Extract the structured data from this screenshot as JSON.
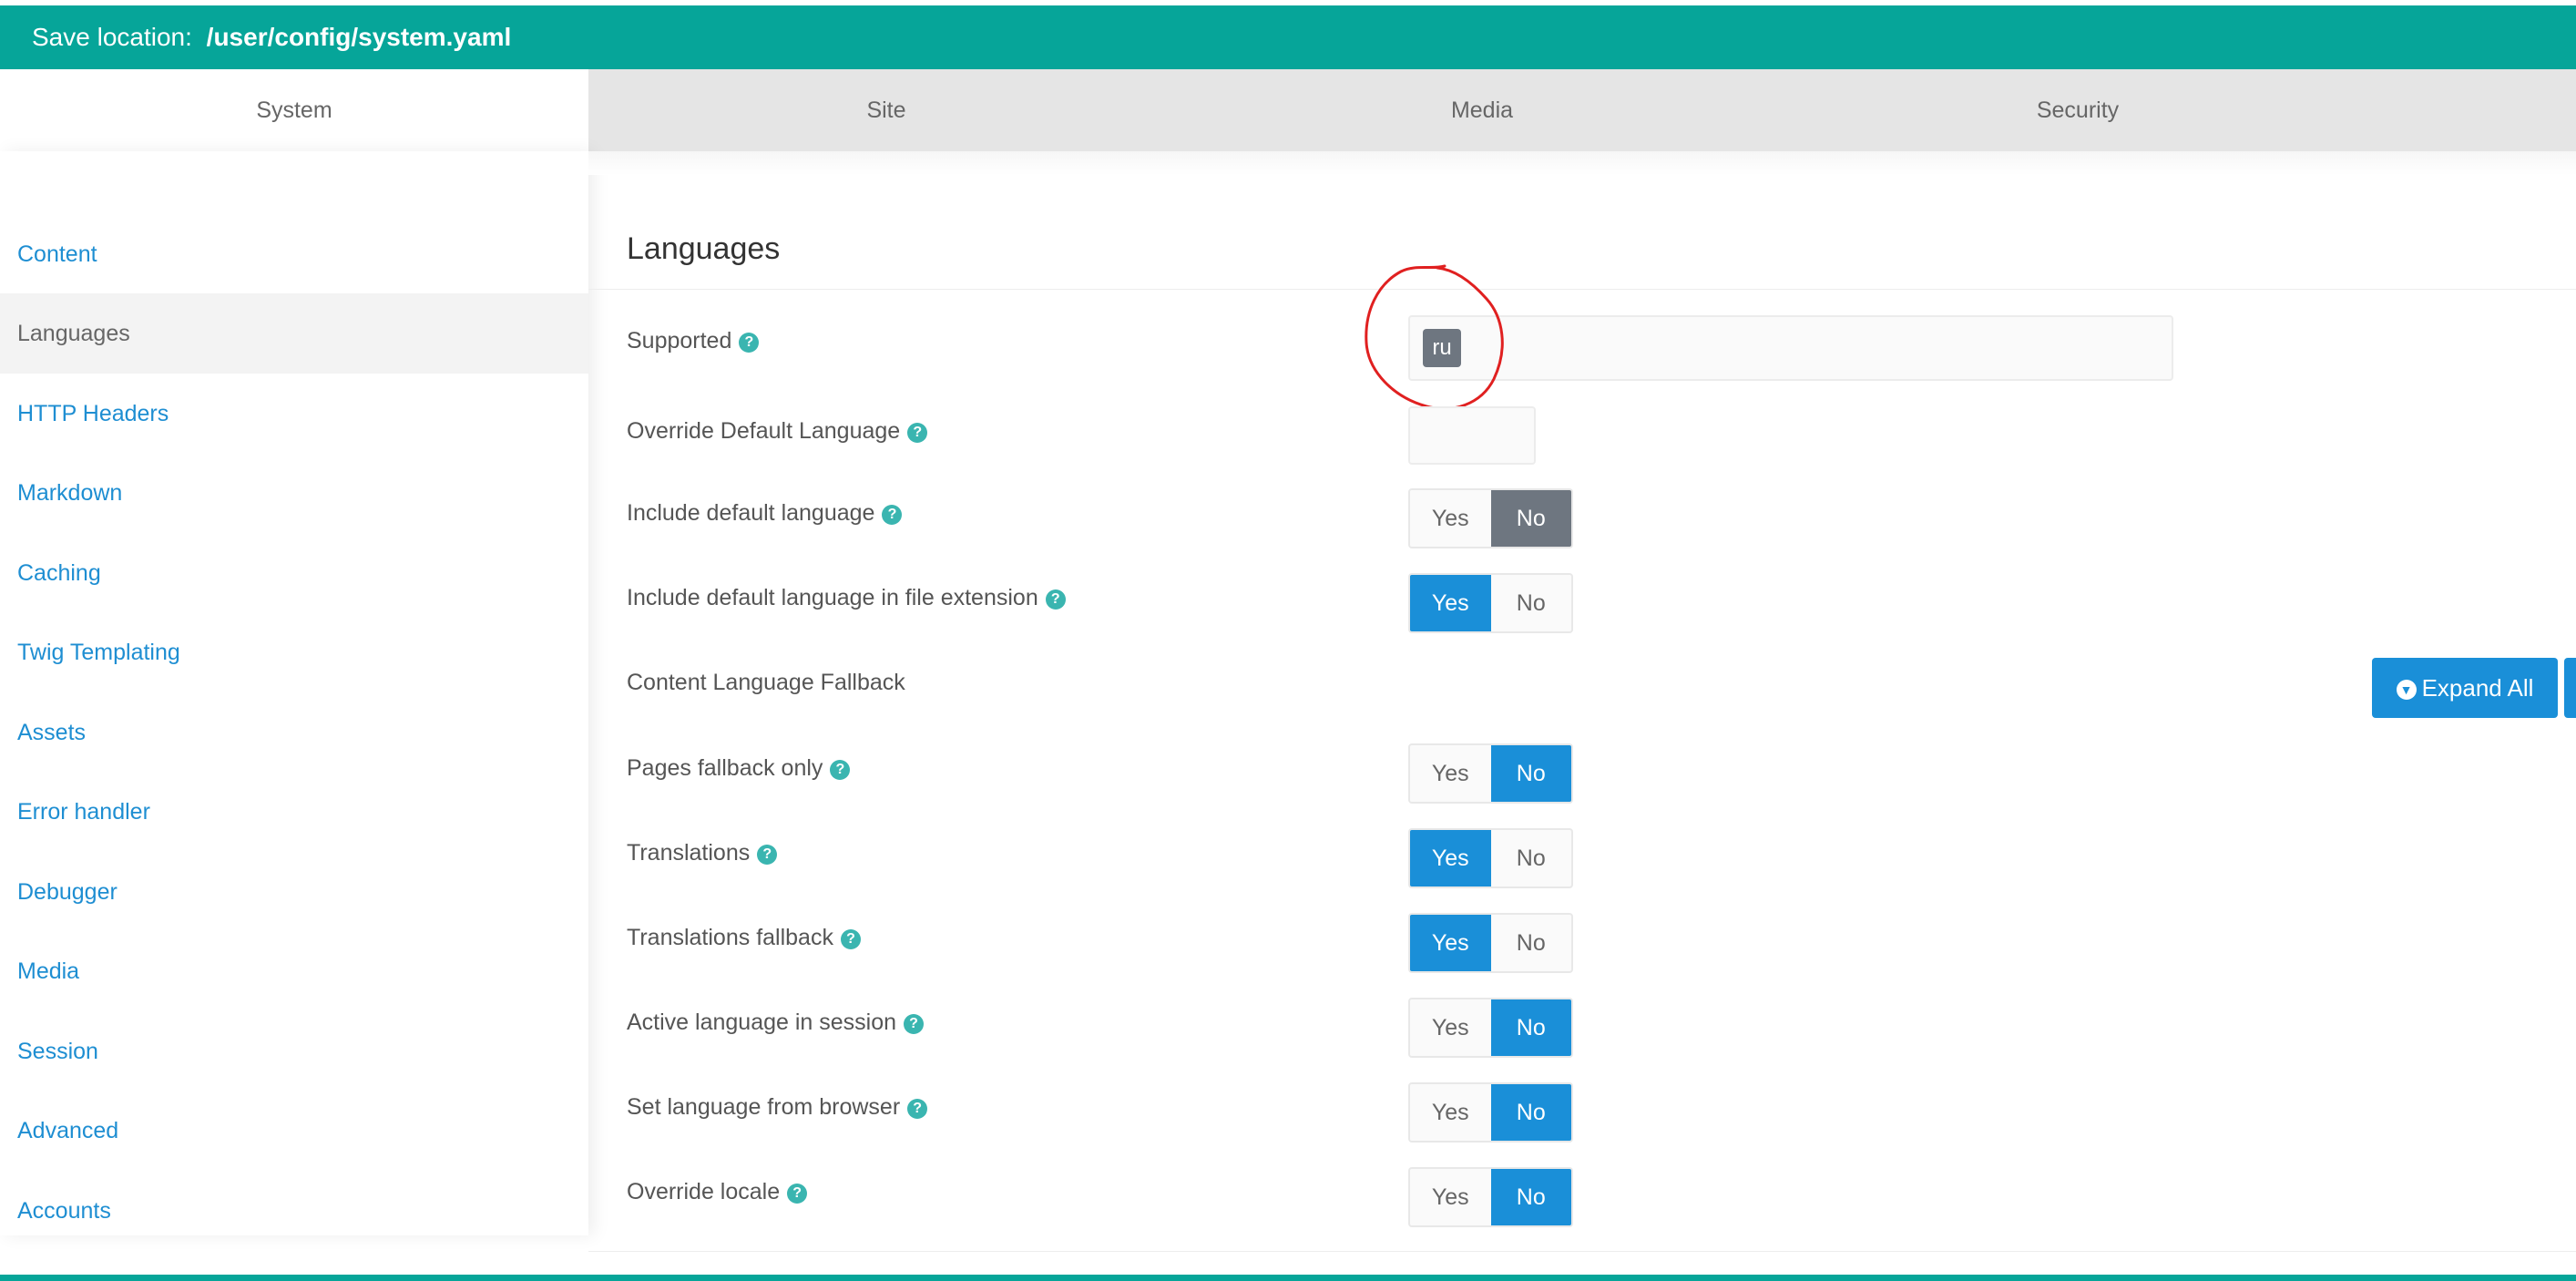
{
  "header": {
    "save_prefix": "Save location:",
    "save_path": "/user/config/system.yaml"
  },
  "tabs": [
    {
      "label": "System",
      "active": true
    },
    {
      "label": "Site"
    },
    {
      "label": "Media"
    },
    {
      "label": "Security"
    }
  ],
  "sidebar": {
    "items": [
      {
        "label": "Content"
      },
      {
        "label": "Languages",
        "active": true
      },
      {
        "label": "HTTP Headers"
      },
      {
        "label": "Markdown"
      },
      {
        "label": "Caching"
      },
      {
        "label": "Twig Templating"
      },
      {
        "label": "Assets"
      },
      {
        "label": "Error handler"
      },
      {
        "label": "Debugger"
      },
      {
        "label": "Media"
      },
      {
        "label": "Session"
      },
      {
        "label": "Advanced"
      },
      {
        "label": "Accounts"
      }
    ]
  },
  "section": {
    "title": "Languages"
  },
  "fields": {
    "supported": {
      "label": "Supported",
      "tag": "ru"
    },
    "override_default": {
      "label": "Override Default Language",
      "value": ""
    },
    "include_default": {
      "label": "Include default language",
      "selected": "No"
    },
    "include_default_ext": {
      "label": "Include default language in file extension",
      "selected": "Yes"
    },
    "fallback_heading": {
      "label": "Content Language Fallback"
    },
    "pages_fallback": {
      "label": "Pages fallback only",
      "selected": "No"
    },
    "translations": {
      "label": "Translations",
      "selected": "Yes"
    },
    "translations_fallback": {
      "label": "Translations fallback",
      "selected": "Yes"
    },
    "active_session": {
      "label": "Active language in session",
      "selected": "No"
    },
    "from_browser": {
      "label": "Set language from browser",
      "selected": "No"
    },
    "override_locale": {
      "label": "Override locale",
      "selected": "No"
    }
  },
  "toggle": {
    "yes": "Yes",
    "no": "No",
    "help": "?"
  },
  "buttons": {
    "expand_all": "Expand All"
  },
  "colors": {
    "teal": "#06a599",
    "blue": "#1a8fd8",
    "gray_selected": "#6e7680",
    "annotation": "#e02020"
  }
}
